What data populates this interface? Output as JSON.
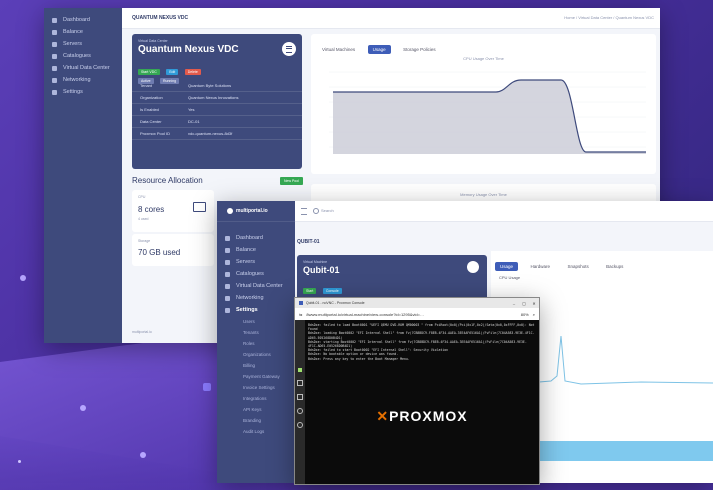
{
  "back": {
    "app_title": "QUANTUM NEXUS VDC",
    "breadcrumb": "Home  /  Virtual Data Center  /  Quantum Nexus VDC",
    "sidebar": [
      "Dashboard",
      "Balance",
      "Servers",
      "Catalogues",
      "Virtual Data Center",
      "Networking",
      "Settings"
    ],
    "card": {
      "kicker": "Virtual Data Center",
      "title": "Quantum Nexus VDC",
      "actions": [
        "Start VDC",
        "Edit",
        "Delete"
      ],
      "badges": [
        "Active",
        "Running"
      ],
      "rows": [
        {
          "k": "Tenant",
          "v": "Quantum Byte Solutions"
        },
        {
          "k": "Organization",
          "v": "Quantum Nexus Innovations"
        },
        {
          "k": "Is Enabled",
          "v": "Yes"
        },
        {
          "k": "Data Center",
          "v": "DC-01"
        },
        {
          "k": "Proxmox Pool ID",
          "v": "vdc-quantum-nexus-8d3f"
        }
      ]
    },
    "tabs": [
      "Virtual Machines",
      "Usage",
      "Storage Policies"
    ],
    "active_tab": "Usage",
    "chart_title": "CPU Usage Over Time",
    "chart2_title": "Memory Usage Over Time",
    "resource": {
      "title": "Resource Allocation",
      "button": "New Pool",
      "cpu_label": "CPU",
      "cpu_value": "8 cores",
      "cpu_sub": "4 used",
      "storage_label": "Storage",
      "storage_value": "70 GB used"
    },
    "footer": "multiportal.io"
  },
  "front": {
    "brand": "multiportal.io",
    "search_placeholder": "Search",
    "page_title": "QUBIT-01",
    "sidebar": [
      {
        "label": "Dashboard",
        "active": false
      },
      {
        "label": "Balance",
        "active": false
      },
      {
        "label": "Servers",
        "active": false
      },
      {
        "label": "Catalogues",
        "active": false
      },
      {
        "label": "Virtual Data Center",
        "active": false
      },
      {
        "label": "Networking",
        "active": false
      },
      {
        "label": "Settings",
        "active": true
      }
    ],
    "sub_items": [
      "Users",
      "Tenants",
      "Roles",
      "Organizations",
      "Billing",
      "Payment Gateway",
      "Invoice Settings",
      "Integrations",
      "API Keys",
      "Branding",
      "Audit Logs"
    ],
    "vm_card": {
      "kicker": "Virtual Machine",
      "title": "Qubit-01",
      "actions": [
        "Start",
        "Console"
      ],
      "badge": "Running"
    },
    "tabs": [
      "Usage",
      "Hardware",
      "Snapshots",
      "Backups"
    ],
    "chart_title": "CPU Usage"
  },
  "console": {
    "title": "Qubit-01 - noVNC - Proxmox Console",
    "url": "8www.multiportal.io/virtual-machine/view-console?id=1295&vid=…",
    "zoom": "80%",
    "lines": [
      "BdsDxe: failed to load Boot0001 \"UEFI QEMU DVD-ROM QM00003 \" from PciRoot(0x0)/Pci(0x1F,0x2)/Sata(0x0,0xFFFF,0x0): Not Found",
      "BdsDxe: loading Boot0002 \"EFI Internal Shell\" from Fv(7CB8BDC9-F8EB-4F34-AAEA-3EE4AF6516A1)/FvFile(7C04A583-9E3E-4F1C-AD65-E05268D0B4D1)",
      "BdsDxe: starting Boot0002 \"EFI Internal Shell\" from Fv(7CB8BDC9-F8EB-4F34-AAEA-3EE4AF6516A1)/FvFile(7C04A583-9E3E-4F1C-AD65-E05268D0B4D1)",
      "BdsDxe: failed to start Boot0002 \"EFI Internal Shell\": Security Violation",
      "BdsDxe: No bootable option or device was found.",
      "BdsDxe: Press any key to enter the Boot Manager Menu."
    ],
    "logo": "PROXMOX"
  }
}
